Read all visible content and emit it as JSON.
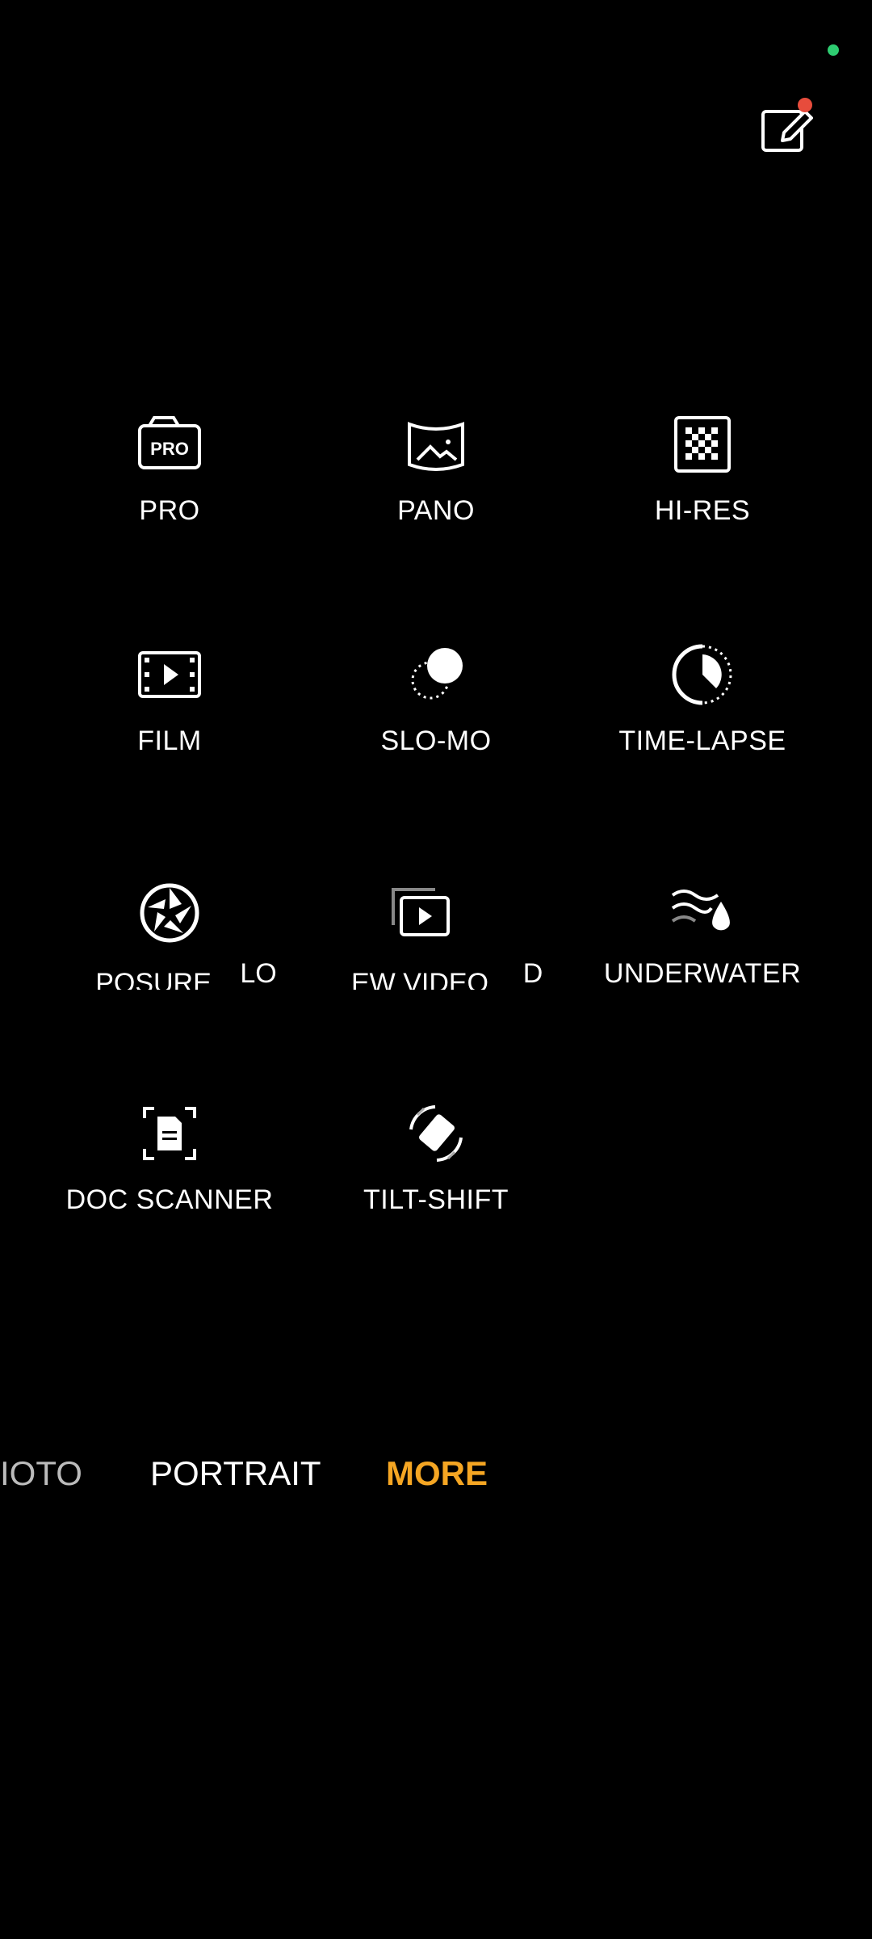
{
  "modes": [
    {
      "label": "PRO",
      "icon": "pro-camera-icon"
    },
    {
      "label": "PANO",
      "icon": "panorama-icon"
    },
    {
      "label": "HI-RES",
      "icon": "hi-res-icon"
    },
    {
      "label": "FILM",
      "icon": "film-icon"
    },
    {
      "label": "SLO-MO",
      "icon": "slo-mo-icon"
    },
    {
      "label": "TIME-LAPSE",
      "icon": "time-lapse-icon"
    },
    {
      "label": "UNDERWATER",
      "icon": "underwater-icon"
    },
    {
      "label": "DOC SCANNER",
      "icon": "doc-scanner-icon"
    },
    {
      "label": "TILT-SHIFT",
      "icon": "tilt-shift-icon"
    }
  ],
  "scroll_items": [
    {
      "label": "POSURE",
      "icon": "aperture-icon"
    },
    {
      "label": "LO"
    },
    {
      "label": "EW VIDEO",
      "icon": "preview-video-icon"
    },
    {
      "label": "D"
    }
  ],
  "tabs": [
    {
      "label": "IOTO"
    },
    {
      "label": "PORTRAIT"
    },
    {
      "label": "MORE"
    }
  ],
  "colors": {
    "accent": "#f5a623",
    "status_dot": "#2ecc71",
    "badge": "#e74c3c"
  }
}
